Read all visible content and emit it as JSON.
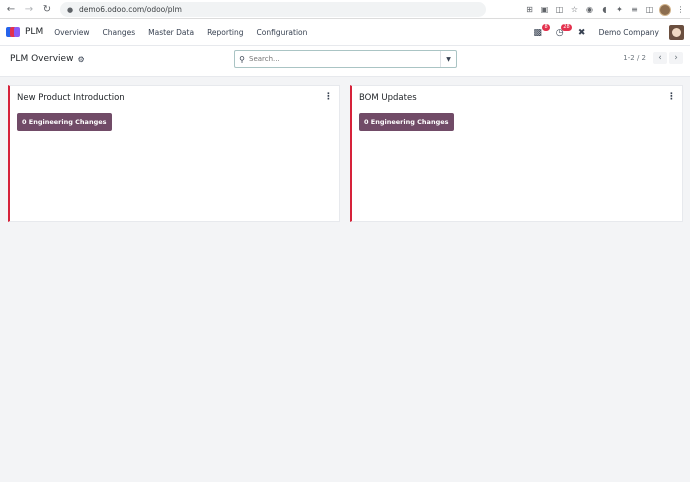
{
  "browser": {
    "url": "demo6.odoo.com/odoo/plm"
  },
  "navbar": {
    "app_name": "PLM",
    "menu": [
      "Overview",
      "Changes",
      "Master Data",
      "Reporting",
      "Configuration"
    ],
    "messages_badge": "8",
    "activity_badge": "28",
    "company": "Demo Company"
  },
  "control": {
    "breadcrumb": "PLM Overview",
    "search_placeholder": "Search...",
    "pager": "1-2 / 2"
  },
  "cards": [
    {
      "title": "New Product Introduction",
      "button_label": "0 Engineering Changes"
    },
    {
      "title": "BOM Updates",
      "button_label": "0 Engineering Changes"
    }
  ],
  "colors": {
    "brand": "#714b67",
    "card_accent": "#d6223a",
    "badge": "#e3314d"
  }
}
